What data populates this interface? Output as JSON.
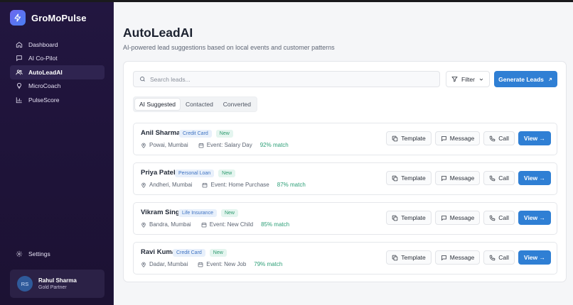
{
  "app": {
    "name": "GroMoPulse"
  },
  "sidebar": {
    "items": [
      {
        "label": "Dashboard",
        "icon": "home-icon",
        "active": false
      },
      {
        "label": "AI Co-Pilot",
        "icon": "chat-icon",
        "active": false
      },
      {
        "label": "AutoLeadAI",
        "icon": "users-icon",
        "active": true
      },
      {
        "label": "MicroCoach",
        "icon": "lightbulb-icon",
        "active": false
      },
      {
        "label": "PulseScore",
        "icon": "bar-chart-icon",
        "active": false
      }
    ],
    "settings_label": "Settings",
    "user": {
      "initials": "RS",
      "name": "Rahul Sharma",
      "role": "Gold Partner"
    }
  },
  "main": {
    "title": "AutoLeadAI",
    "subtitle": "AI-powered lead suggestions based on local events and customer patterns",
    "search_placeholder": "Search leads...",
    "filter_label": "Filter",
    "generate_label": "Generate Leads",
    "tabs": [
      {
        "label": "AI Suggested",
        "active": true
      },
      {
        "label": "Contacted",
        "active": false
      },
      {
        "label": "Converted",
        "active": false
      }
    ],
    "action_labels": {
      "template": "Template",
      "message": "Message",
      "call": "Call",
      "view": "View →"
    },
    "leads": [
      {
        "name": "Anil Sharma",
        "product": "Credit Card",
        "status": "New",
        "location": "Powai, Mumbai",
        "event": "Event: Salary Day",
        "match": "92% match"
      },
      {
        "name": "Priya Patel",
        "product": "Personal Loan",
        "status": "New",
        "location": "Andheri, Mumbai",
        "event": "Event: Home Purchase",
        "match": "87% match"
      },
      {
        "name": "Vikram Singh",
        "product": "Life Insurance",
        "status": "New",
        "location": "Bandra, Mumbai",
        "event": "Event: New Child",
        "match": "85% match"
      },
      {
        "name": "Ravi Kumar",
        "product": "Credit Card",
        "status": "New",
        "location": "Dadar, Mumbai",
        "event": "Event: New Job",
        "match": "79% match"
      }
    ]
  },
  "colors": {
    "sidebar_bg": "#221640",
    "accent": "#2f7fd4",
    "match": "#2b9e76"
  }
}
